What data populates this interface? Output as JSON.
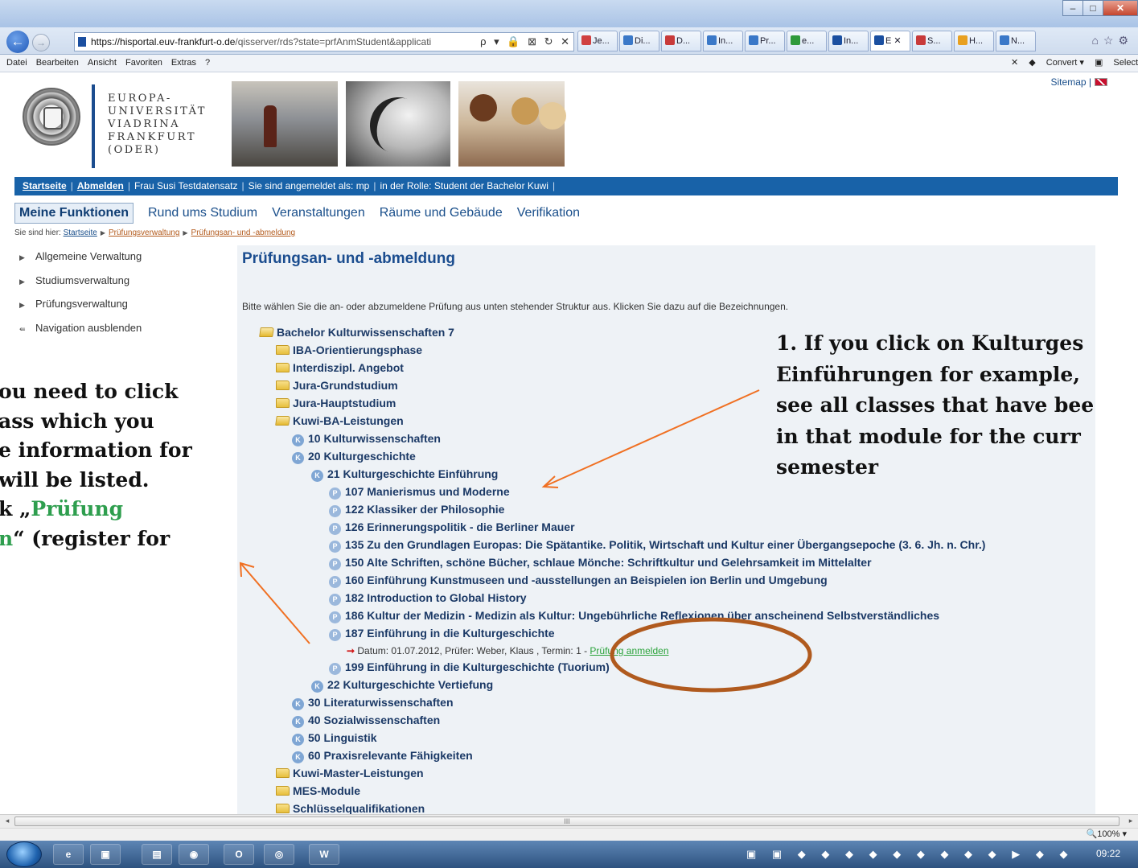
{
  "browser": {
    "url_domain": "https://hisportal.euv-frankfurt-o.de",
    "url_rest": "/qisserver/rds?state=prfAnmStudent&applicati",
    "url_tools": "ρ ▾ 🔒 ⊠ ↻ ✕",
    "tabs": [
      {
        "label": "Je...",
        "color": "#d04040"
      },
      {
        "label": "Di...",
        "color": "#3a78c8"
      },
      {
        "label": "D...",
        "color": "#c83a3a"
      },
      {
        "label": "In...",
        "color": "#3a78c8"
      },
      {
        "label": "Pr...",
        "color": "#3a78c8"
      },
      {
        "label": "e...",
        "color": "#2f9a3a"
      },
      {
        "label": "In...",
        "color": "#1b4fa0"
      },
      {
        "label": "E ✕",
        "color": "#1b4fa0"
      },
      {
        "label": "S...",
        "color": "#c83a3a"
      },
      {
        "label": "H...",
        "color": "#e8a020"
      },
      {
        "label": "N...",
        "color": "#3a78c8"
      }
    ],
    "menu": [
      "Datei",
      "Bearbeiten",
      "Ansicht",
      "Favoriten",
      "Extras",
      "?"
    ],
    "menu_right_close": "✕",
    "convert": "Convert",
    "select": "Select"
  },
  "header": {
    "sitemap": "Sitemap |",
    "logo_lines": [
      "EUROPA-",
      "UNIVERSITÄT",
      "VIADRINA",
      "FRANKFURT",
      "(ODER)"
    ]
  },
  "topbar": {
    "startseite": "Startseite",
    "abmelden": "Abmelden",
    "user": "Frau Susi Testdatensatz",
    "logged_as": "Sie sind angemeldet als: mp",
    "role": "in der Rolle: Student der Bachelor Kuwi"
  },
  "mainnav": [
    "Meine Funktionen",
    "Rund ums Studium",
    "Veranstaltungen",
    "Räume und Gebäude",
    "Verifikation"
  ],
  "breadcrumb": {
    "prefix": "Sie sind hier:",
    "items": [
      "Startseite",
      "Prüfungsverwaltung",
      "Prüfungsan- und -abmeldung"
    ]
  },
  "sidenav": [
    "Allgemeine Verwaltung",
    "Studiumsverwaltung",
    "Prüfungsverwaltung",
    "Navigation ausblenden"
  ],
  "content": {
    "title": "Prüfungsan- und -abmeldung",
    "intro": "Bitte wählen Sie die an- oder abzumeldene Prüfung aus unten stehender Struktur aus. Klicken Sie dazu auf die Bezeichnungen.",
    "tree": [
      {
        "kind": "folder-open",
        "label": "Bachelor Kulturwissenschaften 7"
      },
      {
        "kind": "folder",
        "label": "IBA-Orientierungsphase"
      },
      {
        "kind": "folder",
        "label": "Interdiszipl. Angebot"
      },
      {
        "kind": "folder",
        "label": "Jura-Grundstudium"
      },
      {
        "kind": "folder",
        "label": "Jura-Hauptstudium"
      },
      {
        "kind": "folder-open",
        "label": "Kuwi-BA-Leistungen"
      },
      {
        "kind": "k",
        "label": "10 Kulturwissenschaften"
      },
      {
        "kind": "k",
        "label": "20 Kulturgeschichte"
      },
      {
        "kind": "k",
        "label": "21 Kulturgeschichte Einführung"
      },
      {
        "kind": "p",
        "label": "107 Manierismus und Moderne"
      },
      {
        "kind": "p",
        "label": "122 Klassiker der Philosophie"
      },
      {
        "kind": "p",
        "label": "126 Erinnerungspolitik - die Berliner Mauer"
      },
      {
        "kind": "p",
        "label": "135 Zu den Grundlagen Europas: Die Spätantike. Politik, Wirtschaft und Kultur einer Übergangsepoche (3. 6. Jh. n. Chr.)"
      },
      {
        "kind": "p",
        "label": "150 Alte Schriften, schöne Bücher, schlaue Mönche: Schriftkultur und Gelehrsamkeit im Mittelalter"
      },
      {
        "kind": "p",
        "label": "160 Einführung Kunstmuseen und -ausstellungen an Beispielen ion Berlin und Umgebung"
      },
      {
        "kind": "p",
        "label": "182 Introduction to Global History"
      },
      {
        "kind": "p",
        "label": "186 Kultur der Medizin - Medizin als Kultur: Ungebührliche Reflexionen über anscheinend Selbstverständliches"
      },
      {
        "kind": "p",
        "label": "187 Einführung in die Kulturgeschichte"
      },
      {
        "kind": "detail",
        "label": "Datum: 01.07.2012, Prüfer: Weber, Klaus , Termin: 1 -",
        "link": "Prüfung anmelden"
      },
      {
        "kind": "p",
        "label": "199 Einführung in die Kulturgeschichte (Tuorium)"
      },
      {
        "kind": "k",
        "label": "22 Kulturgeschichte Vertiefung"
      },
      {
        "kind": "k",
        "label": "30 Literaturwissenschaften"
      },
      {
        "kind": "k",
        "label": "40 Sozialwissenschaften"
      },
      {
        "kind": "k",
        "label": "50 Linguistik"
      },
      {
        "kind": "k",
        "label": "60 Praxisrelevante Fähigkeiten"
      },
      {
        "kind": "folder",
        "label": "Kuwi-Master-Leistungen"
      },
      {
        "kind": "folder",
        "label": "MES-Module"
      },
      {
        "kind": "folder",
        "label": "Schlüsselqualifikationen"
      }
    ]
  },
  "annotations": {
    "right": [
      "1. If you click on Kulturges",
      "Einführungen for example,",
      "see all classes that have bee",
      "in that module for the curr",
      "semester"
    ],
    "left_lines": [
      "ou need to click",
      "ass which you",
      "e information for",
      " will be listed."
    ],
    "left_line5_a": "k „",
    "left_line5_b": "Prüfung",
    "left_line6_a": "n",
    "left_line6_b": "“ (register for"
  },
  "status": {
    "zoom": "🔍100%  ▾",
    "scroll_mark": "III"
  },
  "taskbar": {
    "items": [
      "e",
      "▣",
      "▤",
      "◉",
      "O",
      "◎",
      "W"
    ],
    "tray": "▣ ▣ ◆ ◆ ◆ ◆ ◆ ◆ ◆ ◆ ◆ ▶ ◆ ◆",
    "clock": "09:22"
  },
  "colors": {
    "accent": "#1862a8",
    "annotation_arrow": "#f07022",
    "ellipse": "#b05a1e",
    "register_link": "#2aa33a"
  }
}
